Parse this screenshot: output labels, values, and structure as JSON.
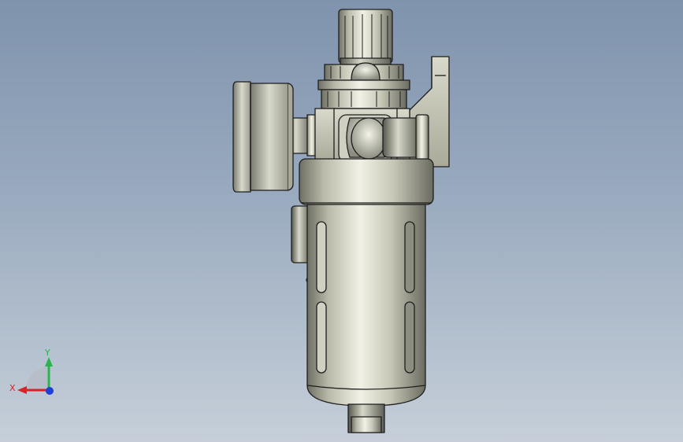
{
  "viewport": {
    "background_top": "#7f93ad",
    "background_bottom": "#c6cfd9"
  },
  "model": {
    "part": "filter-regulator-with-gauge",
    "body_color": "#c9cabb",
    "edge_color": "#1e1e1e"
  },
  "triad": {
    "x_label": "X",
    "y_label": "Y",
    "x_color": "#d8232a",
    "y_color": "#2bb24c",
    "z_color": "#1f3fd6"
  }
}
